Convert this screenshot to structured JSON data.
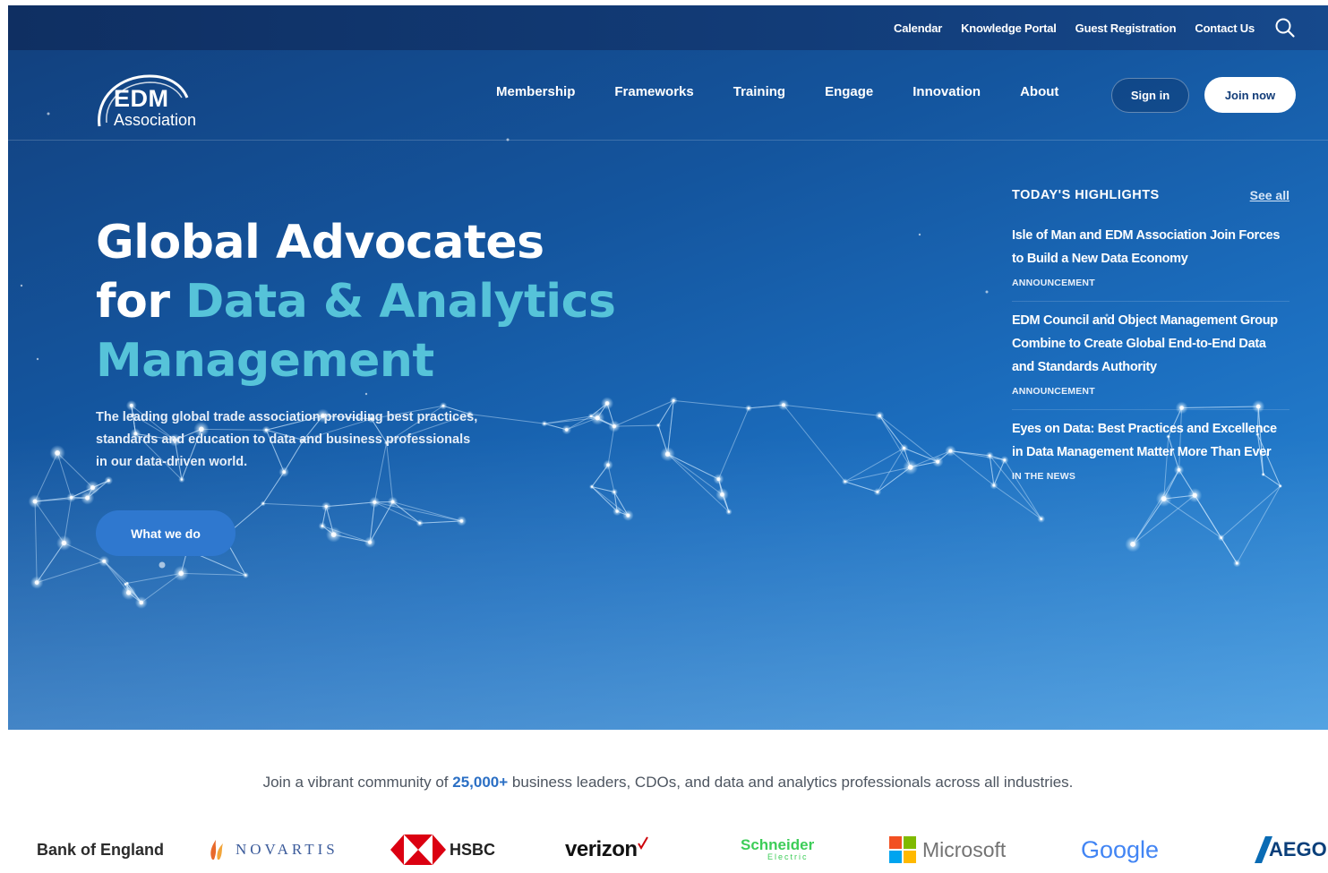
{
  "utility_nav": {
    "links": [
      "Calendar",
      "Knowledge Portal",
      "Guest Registration",
      "Contact Us"
    ],
    "search_icon": "search-icon"
  },
  "logo": {
    "line1": "EDM",
    "line2": "Association"
  },
  "main_nav": {
    "links": [
      "Membership",
      "Frameworks",
      "Training",
      "Engage",
      "Innovation",
      "About"
    ],
    "sign_in": "Sign in",
    "join_now": "Join now"
  },
  "hero": {
    "headline_line1": "Global Advocates",
    "headline_for": "for ",
    "headline_accent1": "Data & Analytics",
    "headline_accent2": "Management",
    "subcopy": "The leading global trade association providing best practices, standards and education to data and business professionals in our data-driven world.",
    "cta": "What we do"
  },
  "highlights": {
    "title": "TODAY'S HIGHLIGHTS",
    "see_all": "See all",
    "items": [
      {
        "title": "Isle of Man and EDM Association Join Forces to Build a New Data Economy",
        "tag": "ANNOUNCEMENT"
      },
      {
        "title": "EDM Council and Object Management Group Combine to Create Global End-to-End Data and Standards Authority",
        "tag": "ANNOUNCEMENT"
      },
      {
        "title": "Eyes on Data: Best Practices and Excellence in Data Management Matter More Than Ever",
        "tag": "IN THE NEWS"
      }
    ]
  },
  "community": {
    "before": "Join a vibrant community of ",
    "count": "25,000+",
    "after": " business leaders, CDOs, and data and analytics professionals across all industries."
  },
  "partner_logos": {
    "bank_of_england": "Bank of England",
    "novartis": "NOVARTIS",
    "hsbc": "HSBC",
    "verizon": "verizon",
    "schneider_1": "Schneider",
    "schneider_2": "Electric",
    "microsoft": "Microsoft",
    "google": "Google",
    "aegon": "AEGON"
  },
  "colors": {
    "hero_dark": "#123f7c",
    "hero_light": "#2f8fdc",
    "accent_teal": "#56c3d9",
    "cta_blue": "#2f78cf",
    "community_accent": "#2b6fc4"
  }
}
